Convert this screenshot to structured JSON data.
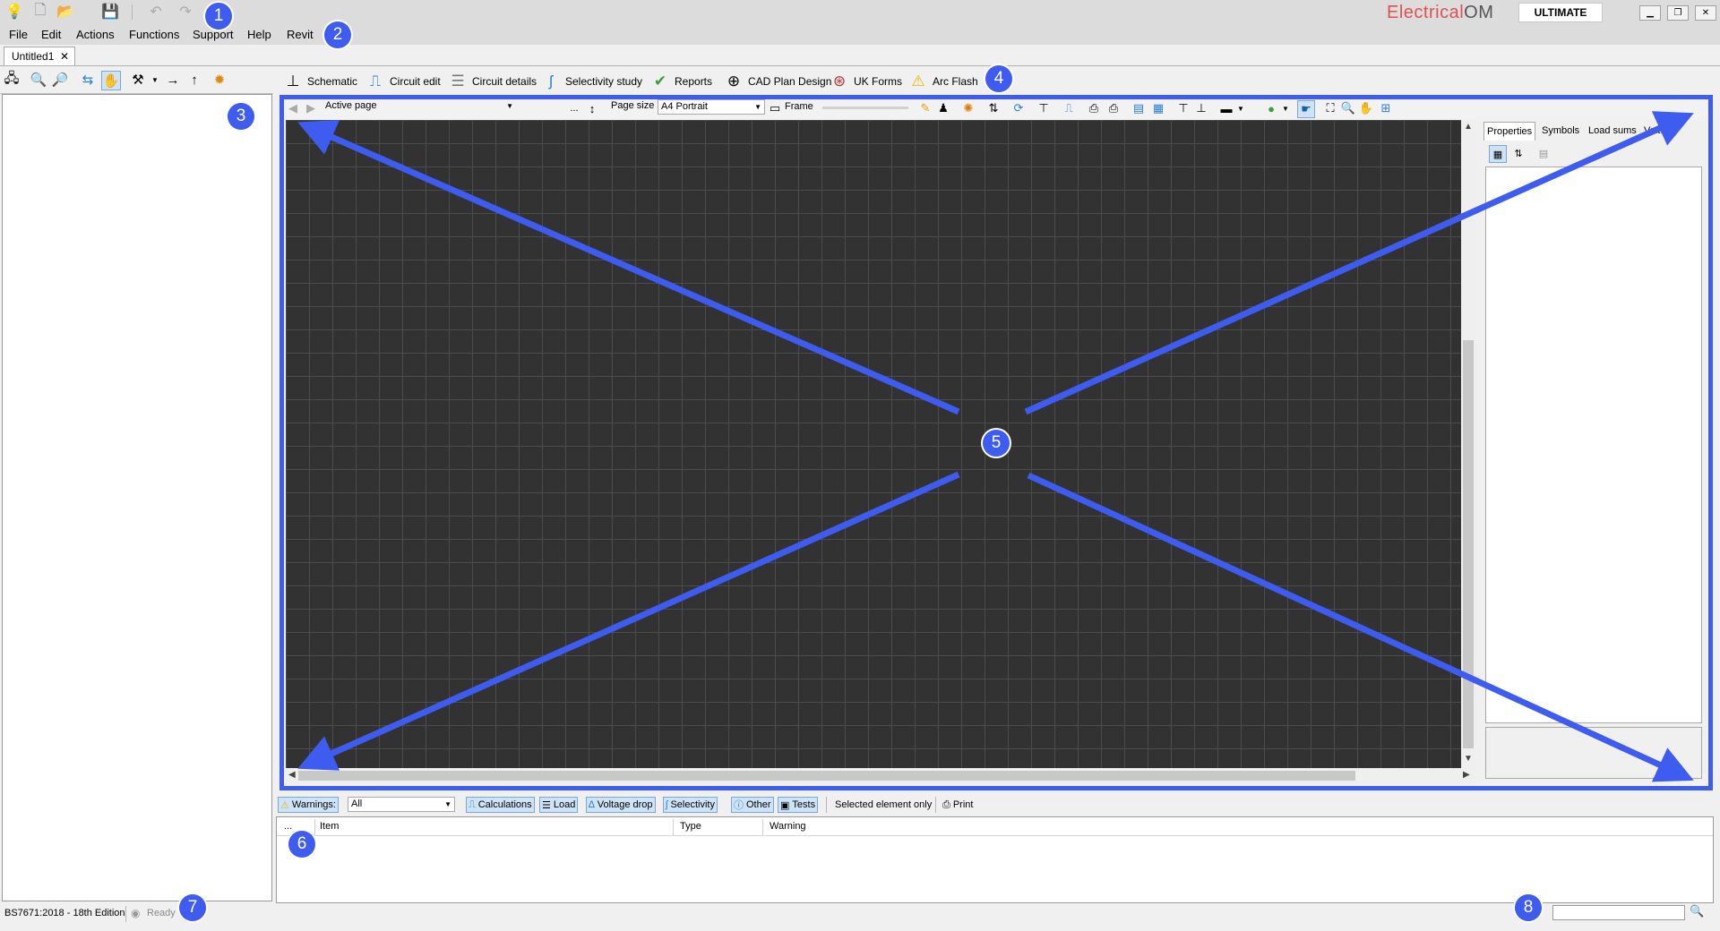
{
  "app": {
    "brand_prefix": "Electrical",
    "brand_suffix": "OM",
    "edition": "ULTIMATE",
    "brand_color": "#e05050"
  },
  "quick_access": {
    "icons": [
      "lightbulb-icon",
      "new-file-icon",
      "open-folder-icon",
      "save-icon",
      "undo-icon",
      "redo-icon"
    ]
  },
  "window_controls": [
    "minimize-icon",
    "restore-icon",
    "close-icon"
  ],
  "menu": [
    "File",
    "Edit",
    "Actions",
    "Functions",
    "Support",
    "Help",
    "Revit"
  ],
  "document_tab": {
    "label": "Untitled1",
    "close": "✕"
  },
  "module_tabs": [
    "Schematic",
    "Circuit edit",
    "Circuit details",
    "Selectivity study",
    "Reports",
    "CAD Plan Design",
    "UK Forms",
    "Arc Flash"
  ],
  "drawing_toolbar": {
    "active_page_label": "Active page",
    "active_page_more": "...",
    "page_size_label": "Page size",
    "page_size_value": "A4 Portrait",
    "frame_label": "Frame"
  },
  "properties_tabs": [
    "Properties",
    "Symbols",
    "Load sums",
    "Volt..."
  ],
  "warnings_toolbar": {
    "warnings_label": "Warnings:",
    "filter_value": "All",
    "buttons": [
      "Calculations",
      "Load",
      "Voltage drop",
      "Selectivity",
      "Other",
      "Tests"
    ],
    "selected_only": "Selected element only",
    "print": "Print"
  },
  "warnings_columns": [
    "...",
    "Item",
    "Type",
    "Warning"
  ],
  "status": {
    "standard": "BS7671:2018 - 18th Edition",
    "state": "Ready"
  },
  "annotations": [
    "1",
    "2",
    "3",
    "4",
    "5",
    "6",
    "7",
    "8"
  ],
  "annotation_color": "#3f5cf0"
}
